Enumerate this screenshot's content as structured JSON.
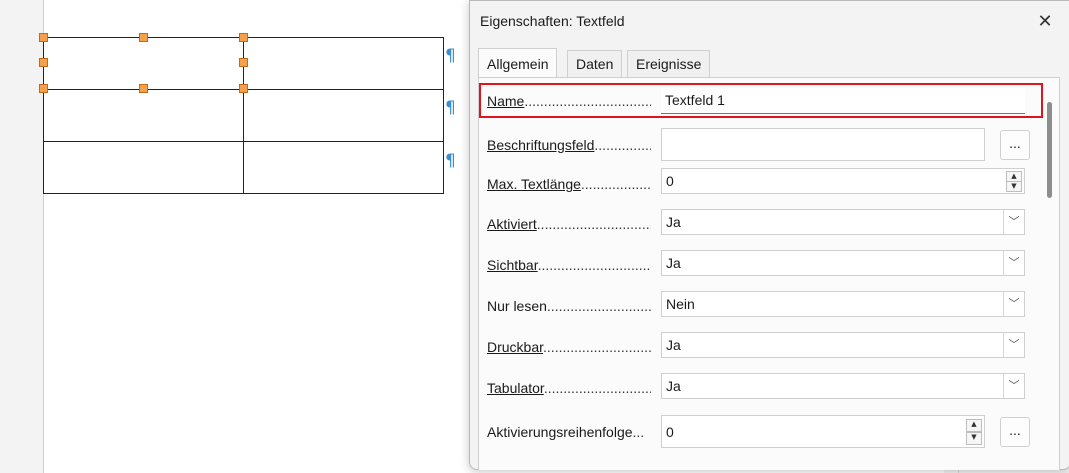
{
  "dialog": {
    "title": "Eigenschaften: Textfeld",
    "close_icon": "close-icon",
    "tabs": [
      {
        "label": "Allgemein",
        "active": true
      },
      {
        "label": "Daten",
        "active": false
      },
      {
        "label": "Ereignisse",
        "active": false
      }
    ],
    "fields": {
      "name": {
        "label": "Name",
        "dots": "...........................................",
        "value": "Textfeld 1"
      },
      "beschriftungsfeld": {
        "label": "Beschriftungsfeld",
        "dots": "...................",
        "value": "",
        "button": "..."
      },
      "max_textlaenge": {
        "label": "Max. Textlänge",
        "dots": ".......................",
        "value": "0"
      },
      "aktiviert": {
        "label": "Aktiviert",
        "dots": "......................................",
        "value": "Ja"
      },
      "sichtbar": {
        "label": "Sichtbar",
        "dots": ".......................................",
        "value": "Ja"
      },
      "nur_lesen": {
        "label": "Nur lesen",
        "dots": "..................................",
        "value": "Nein"
      },
      "druckbar": {
        "label": "Druckbar",
        "dots": "....................................",
        "value": "Ja"
      },
      "tabulator": {
        "label": "Tabulator",
        "dots": "..................................",
        "value": "Ja"
      },
      "aktivierungsreihenfolge": {
        "label": "Aktivierungsreihenfolge",
        "dots": "...",
        "value": "0",
        "button": "..."
      }
    }
  },
  "document": {
    "pilcrow": "¶"
  },
  "colors": {
    "highlight": "#e0141e",
    "handle": "#f4a14a",
    "pilcrow": "#3a8fd0"
  }
}
